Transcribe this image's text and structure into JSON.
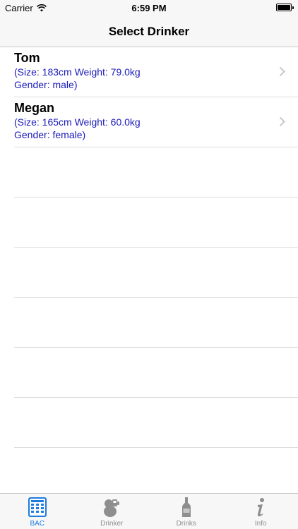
{
  "status_bar": {
    "carrier": "Carrier",
    "time": "6:59 PM"
  },
  "nav": {
    "title": "Select Drinker"
  },
  "drinkers": [
    {
      "name": "Tom",
      "detail_line1": "(Size: 183cm Weight: 79.0kg",
      "detail_line2": "Gender: male)"
    },
    {
      "name": "Megan",
      "detail_line1": "(Size: 165cm Weight: 60.0kg",
      "detail_line2": "Gender: female)"
    }
  ],
  "tabs": [
    {
      "label": "BAC",
      "icon": "calculator-icon",
      "active": true
    },
    {
      "label": "Drinker",
      "icon": "drinker-icon",
      "active": false
    },
    {
      "label": "Drinks",
      "icon": "bottle-icon",
      "active": false
    },
    {
      "label": "Info",
      "icon": "info-icon",
      "active": false
    }
  ],
  "colors": {
    "accent": "#1e7be0",
    "detail_text": "#1a1ab8",
    "inactive": "#8e8e8e"
  }
}
